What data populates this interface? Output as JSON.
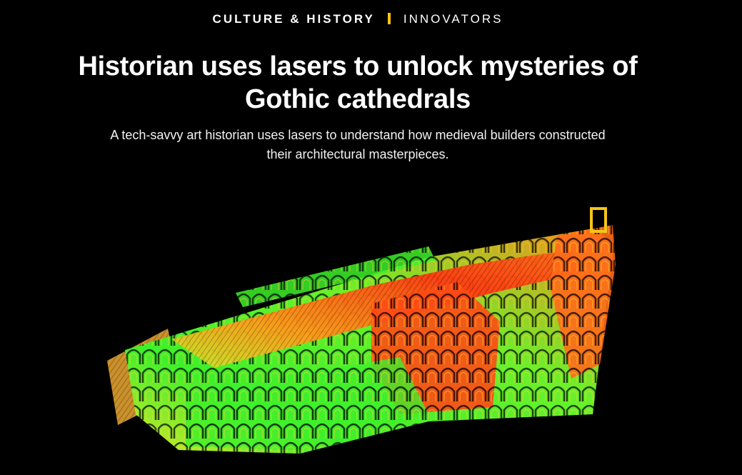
{
  "header": {
    "category": "CULTURE & HISTORY",
    "subcategory": "INNOVATORS",
    "separator_color": "#f5c518"
  },
  "article": {
    "title": "Historian uses lasers to unlock mysteries of Gothic cathedrals",
    "dek": "A tech-savvy art historian uses lasers to understand how medieval builders constructed their architectural masterpieces."
  },
  "hero_image": {
    "subject": "laser-scan-point-cloud-of-gothic-cathedral",
    "logo": "yellow-rectangle-border-logo",
    "colors": {
      "background": "#000000",
      "green": "#3ef02a",
      "yellow": "#d9e82a",
      "orange": "#ff7a1a",
      "red": "#ff3b12",
      "logo": "#f5c518"
    }
  }
}
